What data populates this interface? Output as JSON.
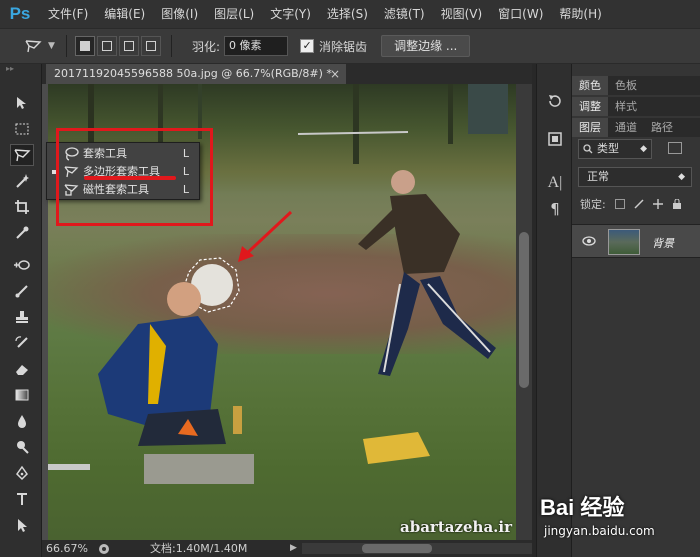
{
  "app": {
    "logo": "Ps"
  },
  "menu": [
    "文件(F)",
    "编辑(E)",
    "图像(I)",
    "图层(L)",
    "文字(Y)",
    "选择(S)",
    "滤镜(T)",
    "视图(V)",
    "窗口(W)",
    "帮助(H)"
  ],
  "options": {
    "feather_label": "羽化:",
    "feather_value": "0 像素",
    "antialias_label": "消除锯齿",
    "antialias_checked": true,
    "refine_edge_label": "调整边缘 ..."
  },
  "document": {
    "tab_title": "20171192045596588 50a.jpg @ 66.7%(RGB/8#) *",
    "close_glyph": "×"
  },
  "status": {
    "zoom": "66.67%",
    "doc_info": "文档:1.40M/1.40M"
  },
  "flyout": {
    "items": [
      {
        "label": "套索工具",
        "key": "L",
        "icon": "lasso-icon"
      },
      {
        "label": "多边形套索工具",
        "key": "L",
        "icon": "polygonal-lasso-icon",
        "selected": true
      },
      {
        "label": "磁性套索工具",
        "key": "L",
        "icon": "magnetic-lasso-icon"
      }
    ]
  },
  "panels": {
    "row1": [
      "颜色",
      "色板"
    ],
    "row2": [
      "调整",
      "样式"
    ],
    "row3": [
      "图层",
      "通道",
      "路径"
    ],
    "layer_filter": "类型",
    "blend_mode": "正常",
    "lock_label": "锁定:",
    "layers": [
      {
        "name": "背景",
        "visible": true
      }
    ]
  },
  "watermarks": {
    "site": "abartazeha.ir",
    "baidu_logo": "Bai 经验",
    "baidu_url": "jingyan.baidu.com"
  },
  "colors": {
    "annotation_red": "#e0181c",
    "ps_blue": "#3aa7e0"
  }
}
